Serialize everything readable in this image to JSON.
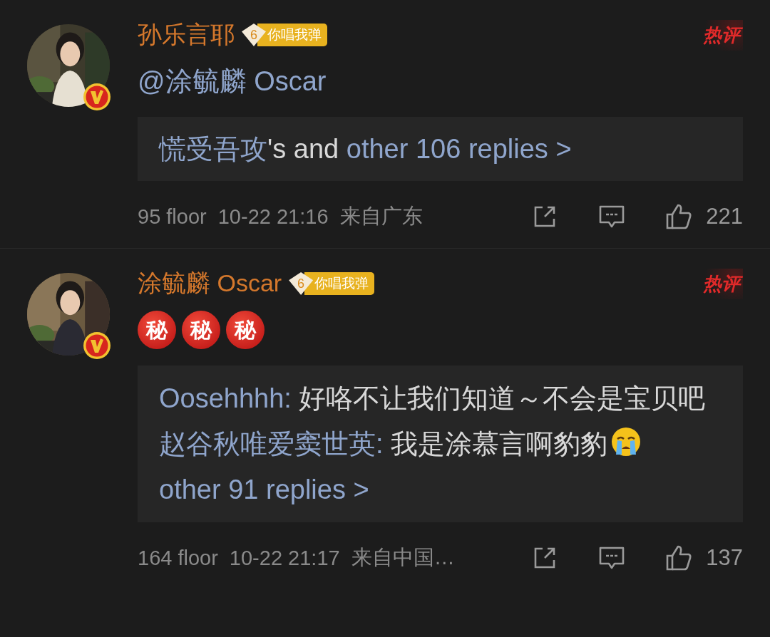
{
  "comments": [
    {
      "user": "孙乐言耶",
      "level": "6",
      "badge": "你唱我弹",
      "hot_label": "热评",
      "verified": true,
      "avatar": {
        "kind": "picture"
      },
      "content": [
        {
          "kind": "mention",
          "text": "@涂毓麟 Oscar"
        }
      ],
      "replies": [
        {
          "segments": [
            {
              "kind": "name",
              "text": "慌受吾攻"
            },
            {
              "kind": "plain",
              "text": "'s and "
            },
            {
              "kind": "link",
              "text": "other 106 replies >"
            }
          ]
        }
      ],
      "floor": "95 floor",
      "time": "10-22 21:16",
      "location": "来自广东",
      "likes": "221"
    },
    {
      "user": "涂毓麟 Oscar",
      "level": "6",
      "badge": "你唱我弹",
      "hot_label": "热评",
      "verified": true,
      "avatar": {
        "kind": "picture"
      },
      "content": [
        {
          "kind": "emoji",
          "text": "秘"
        },
        {
          "kind": "emoji",
          "text": "秘"
        },
        {
          "kind": "emoji",
          "text": "秘"
        }
      ],
      "replies": [
        {
          "segments": [
            {
              "kind": "name",
              "text": "Oosehhhh:"
            },
            {
              "kind": "plain",
              "text": " 好咯不让我们知道～不会是宝贝吧"
            }
          ]
        },
        {
          "segments": [
            {
              "kind": "name",
              "text": "赵谷秋唯爱窦世英:"
            },
            {
              "kind": "plain",
              "text": " 我是涂慕言啊豹豹"
            },
            {
              "kind": "crying_emoji"
            }
          ]
        },
        {
          "segments": [
            {
              "kind": "link",
              "text": "other 91 replies >"
            }
          ]
        }
      ],
      "floor": "164 floor",
      "time": "10-22 21:17",
      "location": "来自中国…",
      "likes": "137"
    }
  ]
}
